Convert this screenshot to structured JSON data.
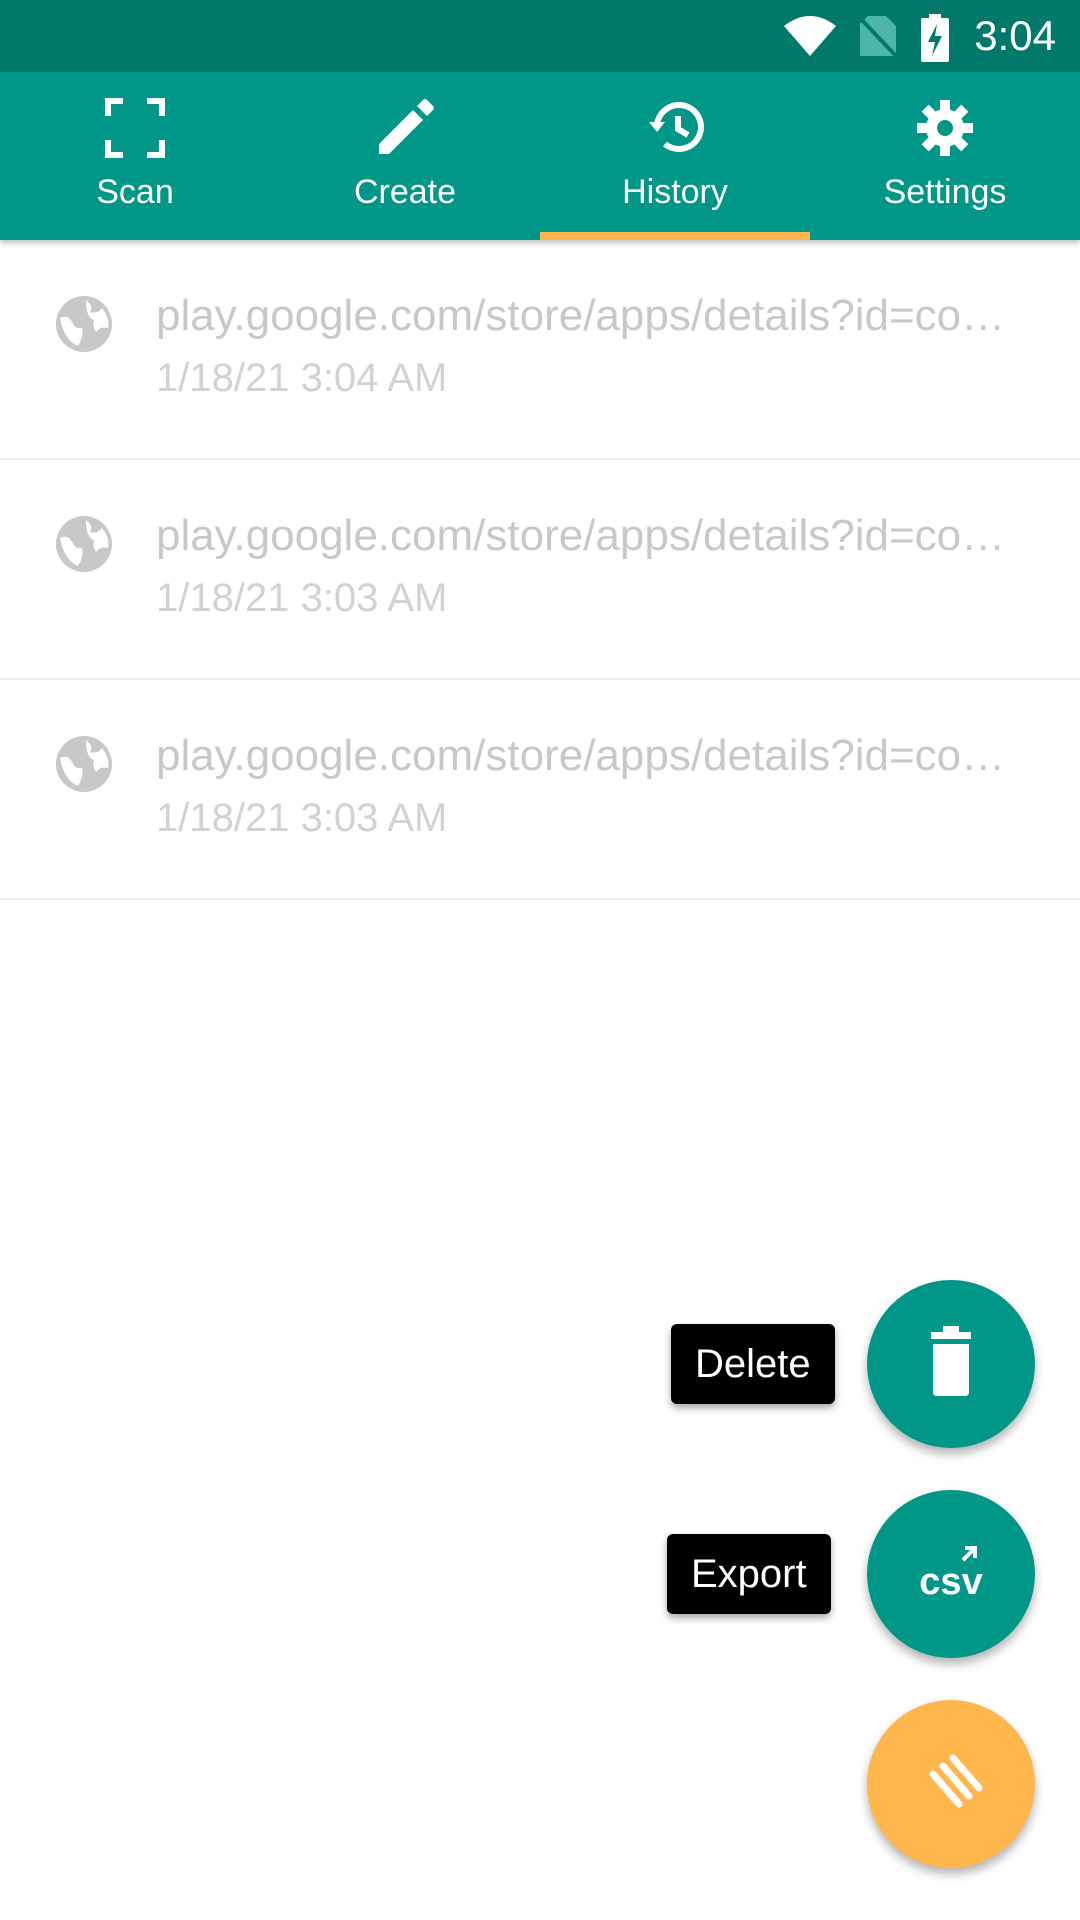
{
  "status_bar": {
    "time": "3:04",
    "icons": [
      "wifi-icon",
      "no-sim-icon",
      "battery-charging-icon"
    ]
  },
  "tabs": [
    {
      "label": "Scan",
      "icon": "scan-frame-icon"
    },
    {
      "label": "Create",
      "icon": "pencil-icon"
    },
    {
      "label": "History",
      "icon": "history-icon",
      "selected": true
    },
    {
      "label": "Settings",
      "icon": "gear-icon"
    }
  ],
  "history": [
    {
      "url": "play.google.com/store/apps/details?id=com.example.app",
      "date": "1/18/21 3:04 AM",
      "icon": "globe-icon"
    },
    {
      "url": "play.google.com/store/apps/details?id=com.example.app",
      "date": "1/18/21 3:03 AM",
      "icon": "globe-icon"
    },
    {
      "url": "play.google.com/store/apps/details?id=com.example.app",
      "date": "1/18/21 3:03 AM",
      "icon": "globe-icon"
    }
  ],
  "fab_menu": {
    "delete_label": "Delete",
    "export_label": "Export",
    "export_icon_text": "csv",
    "toggle_icon": "stripes-icon"
  },
  "colors": {
    "primary": "#009688",
    "primary_dark": "#00796b",
    "accent": "#ffb74d"
  }
}
